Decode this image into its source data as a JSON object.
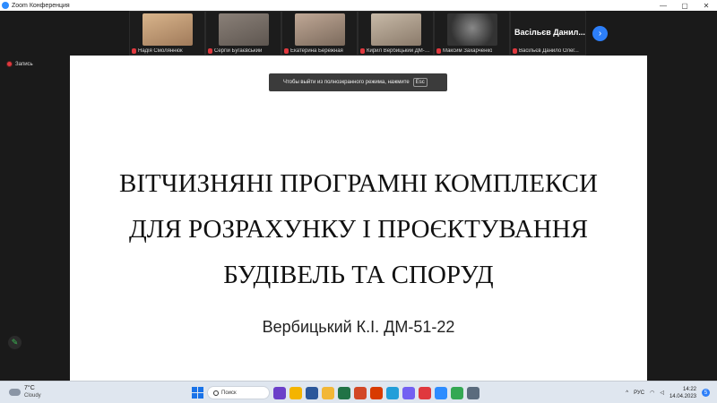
{
  "window": {
    "title": "Zoom Конференция",
    "minimize": "—",
    "maximize": "▢",
    "close": "✕"
  },
  "participants": [
    {
      "name": "Надія Смоляннюк",
      "video_color": "#c9a47a"
    },
    {
      "name": "Сергій Бугаєвський",
      "video_color": "#7a7068"
    },
    {
      "name": "Екатерина Бережная",
      "video_color": "#a89080"
    },
    {
      "name": "Кирил Вербицький ДМ-5...",
      "video_color": "#b0a090"
    },
    {
      "name": "Максим Захарченко",
      "video_color": "#555555"
    },
    {
      "name": "Васільєв Данило Олег...",
      "display_label": "Васільєв Данил..."
    }
  ],
  "next_page_icon": "chevron-right-icon",
  "recording": {
    "label": "Запись"
  },
  "fullscreen_toast": {
    "message": "Чтобы выйти из полноэкранного режима, нажмите",
    "key": "Esc"
  },
  "slide": {
    "title_lines": [
      "ВІТЧИЗНЯНІ ПРОГРАМНІ КОМПЛЕКСИ",
      "ДЛЯ РОЗРАХУНКУ І ПРОЄКТУВАННЯ",
      "БУДІВЕЛЬ ТА СПОРУД"
    ],
    "author": "Вербицький К.І. ДМ-51-22"
  },
  "taskbar": {
    "weather": {
      "temp": "7°C",
      "condition": "Cloudy"
    },
    "search_label": "Поиск",
    "apps": [
      "#6b3fc9",
      "#f4b400",
      "#2b579a",
      "#f2b736",
      "#217346",
      "#d24726",
      "#d83b01",
      "#229ed9",
      "#7360f2",
      "#e0383e",
      "#2d8cff",
      "#34a853",
      "#5a6b7d"
    ],
    "tray": {
      "chevron": "^",
      "language": "РУС",
      "notif": "5"
    },
    "clock": {
      "time": "14:22",
      "date": "14.04.2023"
    }
  }
}
